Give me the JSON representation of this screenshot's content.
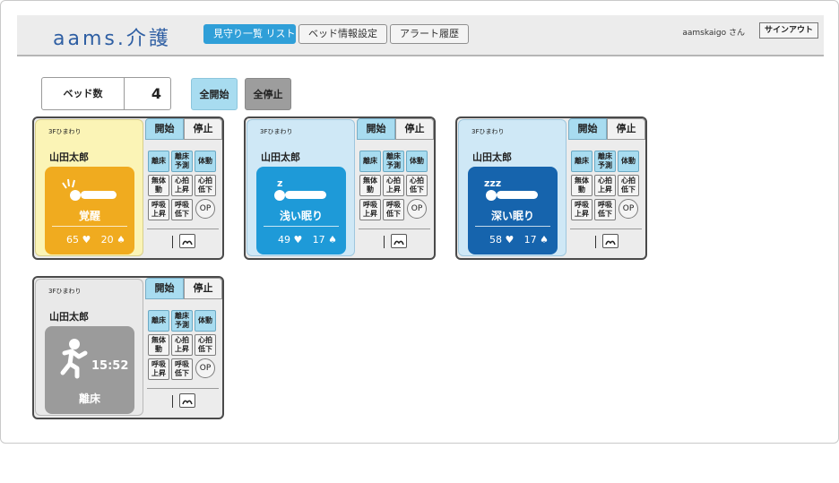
{
  "header": {
    "logo": "aams.介護",
    "tabs": [
      {
        "label": "見守り一覧 リスト",
        "active": true
      },
      {
        "label": "ベッド情報設定",
        "active": false
      },
      {
        "label": "アラート履歴",
        "active": false
      }
    ],
    "user": "aamskaigo さん",
    "signout_label": "サインアウト"
  },
  "toolbar": {
    "bed_count_label": "ベッド数",
    "bed_count_value": "4",
    "all_start_label": "全開始",
    "all_stop_label": "全停止"
  },
  "cards": [
    {
      "room": "3Fひまわり",
      "name": "山田太郎",
      "status": "覚醒",
      "state": "awake",
      "heart_rate": "65",
      "resp_rate": "20",
      "start_label": "開始",
      "stop_label": "停止",
      "alerts": [
        "離床",
        "離床予測",
        "体動",
        "無体動",
        "心拍上昇",
        "心拍低下",
        "呼吸上昇",
        "呼吸低下",
        "OP"
      ]
    },
    {
      "room": "3Fひまわり",
      "name": "山田太郎",
      "status": "浅い眠り",
      "state": "light",
      "heart_rate": "49",
      "resp_rate": "17",
      "start_label": "開始",
      "stop_label": "停止",
      "alerts": [
        "離床",
        "離床予測",
        "体動",
        "無体動",
        "心拍上昇",
        "心拍低下",
        "呼吸上昇",
        "呼吸低下",
        "OP"
      ]
    },
    {
      "room": "3Fひまわり",
      "name": "山田太郎",
      "status": "深い眠り",
      "state": "deep",
      "heart_rate": "58",
      "resp_rate": "17",
      "start_label": "開始",
      "stop_label": "停止",
      "alerts": [
        "離床",
        "離床予測",
        "体動",
        "無体動",
        "心拍上昇",
        "心拍低下",
        "呼吸上昇",
        "呼吸低下",
        "OP"
      ]
    },
    {
      "room": "3Fひまわり",
      "name": "山田太郎",
      "status": "離床",
      "state": "away",
      "away_time": "15:52",
      "start_label": "開始",
      "stop_label": "停止",
      "alerts": [
        "離床",
        "離床予測",
        "体動",
        "無体動",
        "心拍上昇",
        "心拍低下",
        "呼吸上昇",
        "呼吸低下",
        "OP"
      ]
    }
  ],
  "icons": {
    "heart": "heart-icon",
    "lungs": "lungs-icon",
    "sensor": "bed-sensor-icon"
  },
  "colors": {
    "awake": "#f0ab1f",
    "light_sleep": "#1e9ad8",
    "deep_sleep": "#1664ad",
    "away": "#9b9b9b",
    "active_tab": "#2f9fd8",
    "alert_on": "#a8dcf0"
  }
}
